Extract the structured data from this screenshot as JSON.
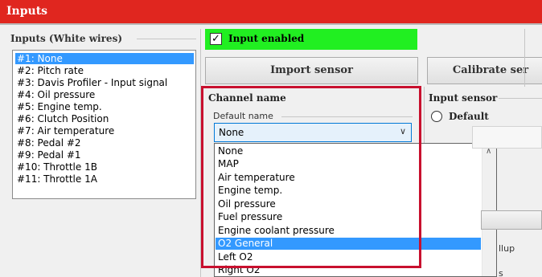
{
  "window": {
    "title": "Inputs"
  },
  "inputs_group": {
    "label": "Inputs (White wires)",
    "items": [
      {
        "label": "#1: None",
        "selected": true
      },
      {
        "label": "#2: Pitch rate"
      },
      {
        "label": "#3: Davis Profiler - Input signal"
      },
      {
        "label": "#4: Oil pressure"
      },
      {
        "label": "#5: Engine temp."
      },
      {
        "label": "#6: Clutch Position"
      },
      {
        "label": "#7: Air temperature"
      },
      {
        "label": "#8: Pedal #2"
      },
      {
        "label": "#9: Pedal #1"
      },
      {
        "label": "#10: Throttle 1B"
      },
      {
        "label": "#11: Throttle 1A"
      }
    ]
  },
  "input_enabled": {
    "label": "Input enabled",
    "checked": true,
    "check_glyph": "✓",
    "bg_color": "#21ef21"
  },
  "buttons": {
    "import_sensor": "Import sensor",
    "calibrate_sensor": "Calibrate ser"
  },
  "channel": {
    "title": "Channel name",
    "default_name_label": "Default name",
    "selected_value": "None",
    "chevron_icon": "chevron-down-icon",
    "options": [
      {
        "label": "None"
      },
      {
        "label": "MAP"
      },
      {
        "label": "Air temperature"
      },
      {
        "label": "Engine temp."
      },
      {
        "label": "Oil pressure"
      },
      {
        "label": "Fuel pressure"
      },
      {
        "label": "Engine coolant pressure"
      },
      {
        "label": "O2 General",
        "highlighted": true
      },
      {
        "label": "Left O2"
      },
      {
        "label": "Right O2"
      }
    ]
  },
  "input_sensor": {
    "title": "Input sensor",
    "default_radio_label": "Default",
    "partial_text_1": "llup",
    "partial_text_2": "s"
  },
  "colors": {
    "titlebar": "#e0261f",
    "highlight_border": "#c8102e",
    "selection": "#3399ff"
  }
}
